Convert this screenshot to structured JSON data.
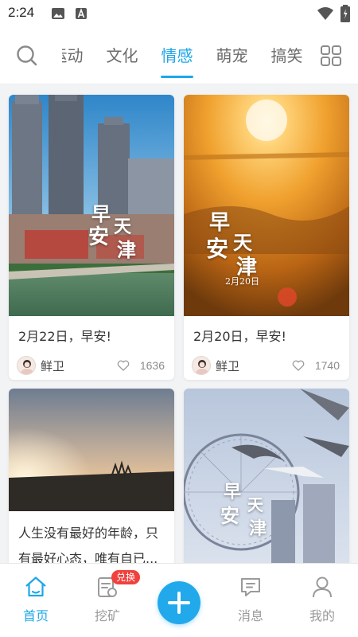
{
  "status_bar": {
    "time": "2:24"
  },
  "tabs": [
    {
      "label": "运动",
      "active": false
    },
    {
      "label": "文化",
      "active": false
    },
    {
      "label": "情感",
      "active": true
    },
    {
      "label": "萌宠",
      "active": false
    },
    {
      "label": "搞笑",
      "active": false
    }
  ],
  "cards": [
    {
      "title": "2月22日，早安!",
      "author": "鲜卫",
      "likes": "1636",
      "image_text": [
        "早",
        "安",
        "天",
        "津"
      ]
    },
    {
      "title": "2月20日，早安!",
      "author": "鲜卫",
      "likes": "1740",
      "image_text": [
        "早",
        "安",
        "天",
        "津"
      ],
      "image_subtext": "2月20日"
    },
    {
      "title": "人生没有最好的年龄，只有最好心态，唯有自已..."
    },
    {
      "image_text": [
        "早",
        "安",
        "天",
        "津"
      ]
    }
  ],
  "bottom_nav": {
    "home": "首页",
    "mine_tasks": "挖矿",
    "exchange_badge": "兑换",
    "messages": "消息",
    "me": "我的"
  },
  "colors": {
    "accent": "#1ea7e8",
    "badge": "#f0413d"
  }
}
